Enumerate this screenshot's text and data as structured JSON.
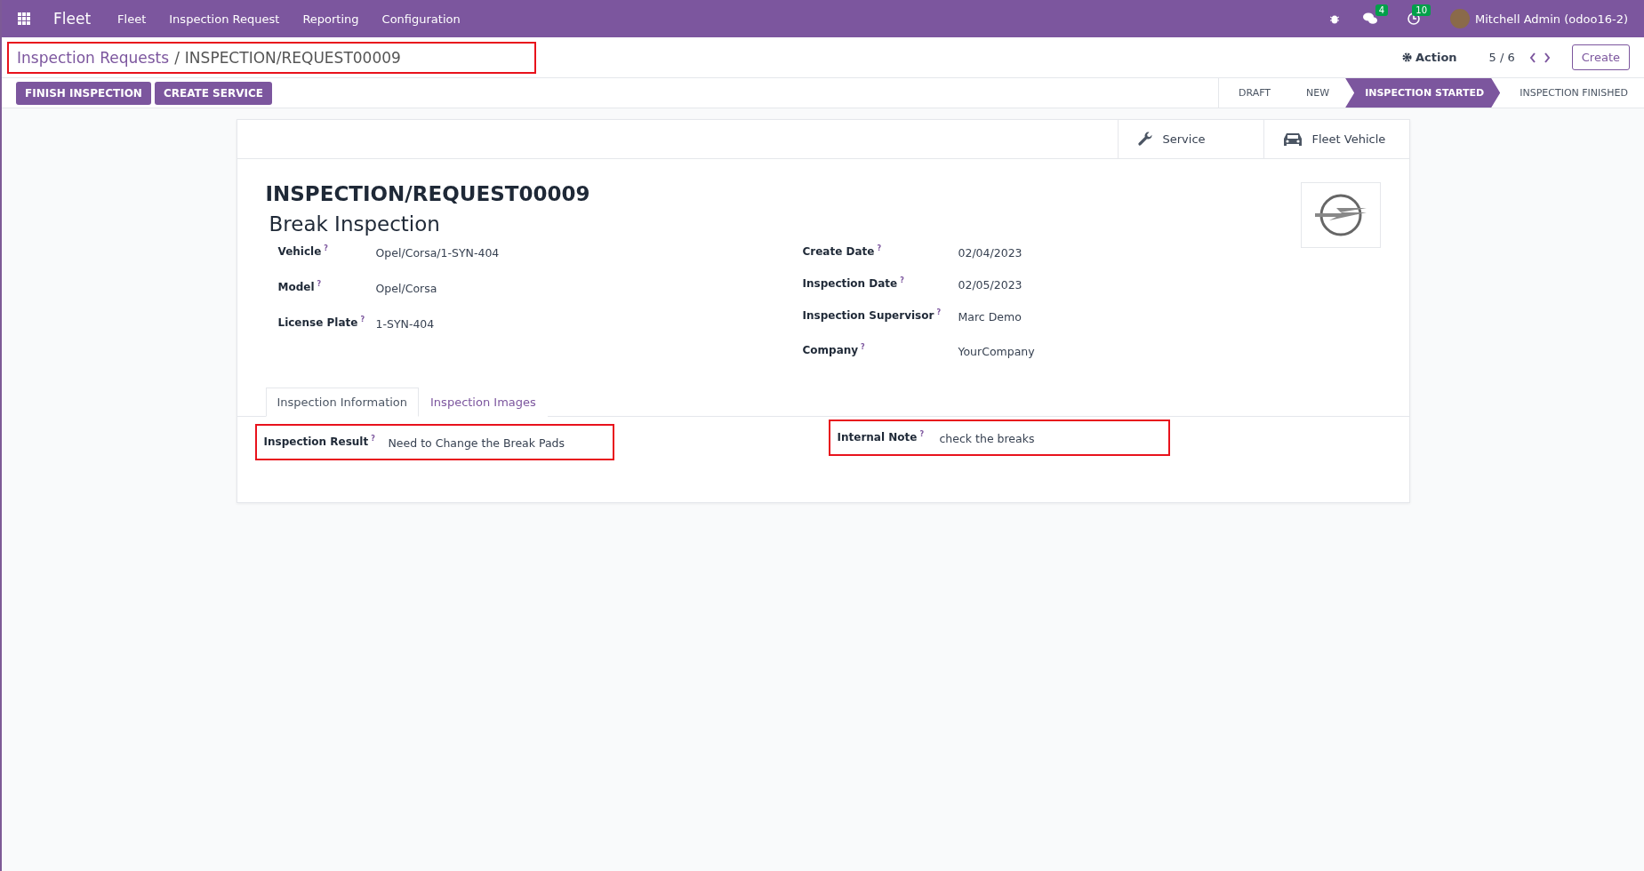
{
  "navbar": {
    "app_title": "Fleet",
    "menu": [
      "Fleet",
      "Inspection Request",
      "Reporting",
      "Configuration"
    ],
    "messages_count": "4",
    "activities_count": "10",
    "user": "Mitchell Admin (odoo16-2)"
  },
  "breadcrumb": {
    "parent": "Inspection Requests",
    "separator": "/",
    "current": "INSPECTION/REQUEST00009",
    "highlighted": true
  },
  "control_panel": {
    "action": "Action",
    "pager": "5 / 6",
    "create": "Create"
  },
  "header_buttons": [
    "FINISH INSPECTION",
    "CREATE SERVICE"
  ],
  "stages": [
    {
      "label": "DRAFT",
      "selected": false
    },
    {
      "label": "NEW",
      "selected": false
    },
    {
      "label": "INSPECTION STARTED",
      "selected": true
    },
    {
      "label": "INSPECTION FINISHED",
      "selected": false
    }
  ],
  "smart_buttons": [
    {
      "kind": "service",
      "label": "Service"
    },
    {
      "kind": "vehicle",
      "label": "Fleet Vehicle"
    }
  ],
  "record": {
    "reference": "INSPECTION/REQUEST00009",
    "name": "Break Inspection"
  },
  "left_fields": [
    {
      "label": "Vehicle",
      "help": "?",
      "value": "Opel/Corsa/1-SYN-404"
    },
    {
      "label": "Model",
      "help": "?",
      "value": "Opel/Corsa"
    },
    {
      "label": "License Plate",
      "help": "?",
      "value": "1-SYN-404"
    }
  ],
  "right_fields": [
    {
      "label": "Create Date",
      "help": "?",
      "value": "02/04/2023"
    },
    {
      "label": "Inspection Date",
      "help": "?",
      "value": "02/05/2023"
    },
    {
      "label": "Inspection Supervisor",
      "help": "?",
      "value": "Marc Demo"
    },
    {
      "label": "Company",
      "help": "?",
      "value": "YourCompany"
    }
  ],
  "tabs": [
    {
      "label": "Inspection Information",
      "selected": true
    },
    {
      "label": "Inspection Images",
      "selected": false
    }
  ],
  "tab_fields": [
    {
      "label": "Inspection Result",
      "help": "?",
      "value": "Need to Change the Break Pads",
      "highlighted": true
    },
    {
      "label": "Internal Note",
      "help": "?",
      "value": "check the breaks",
      "highlighted": true
    }
  ]
}
